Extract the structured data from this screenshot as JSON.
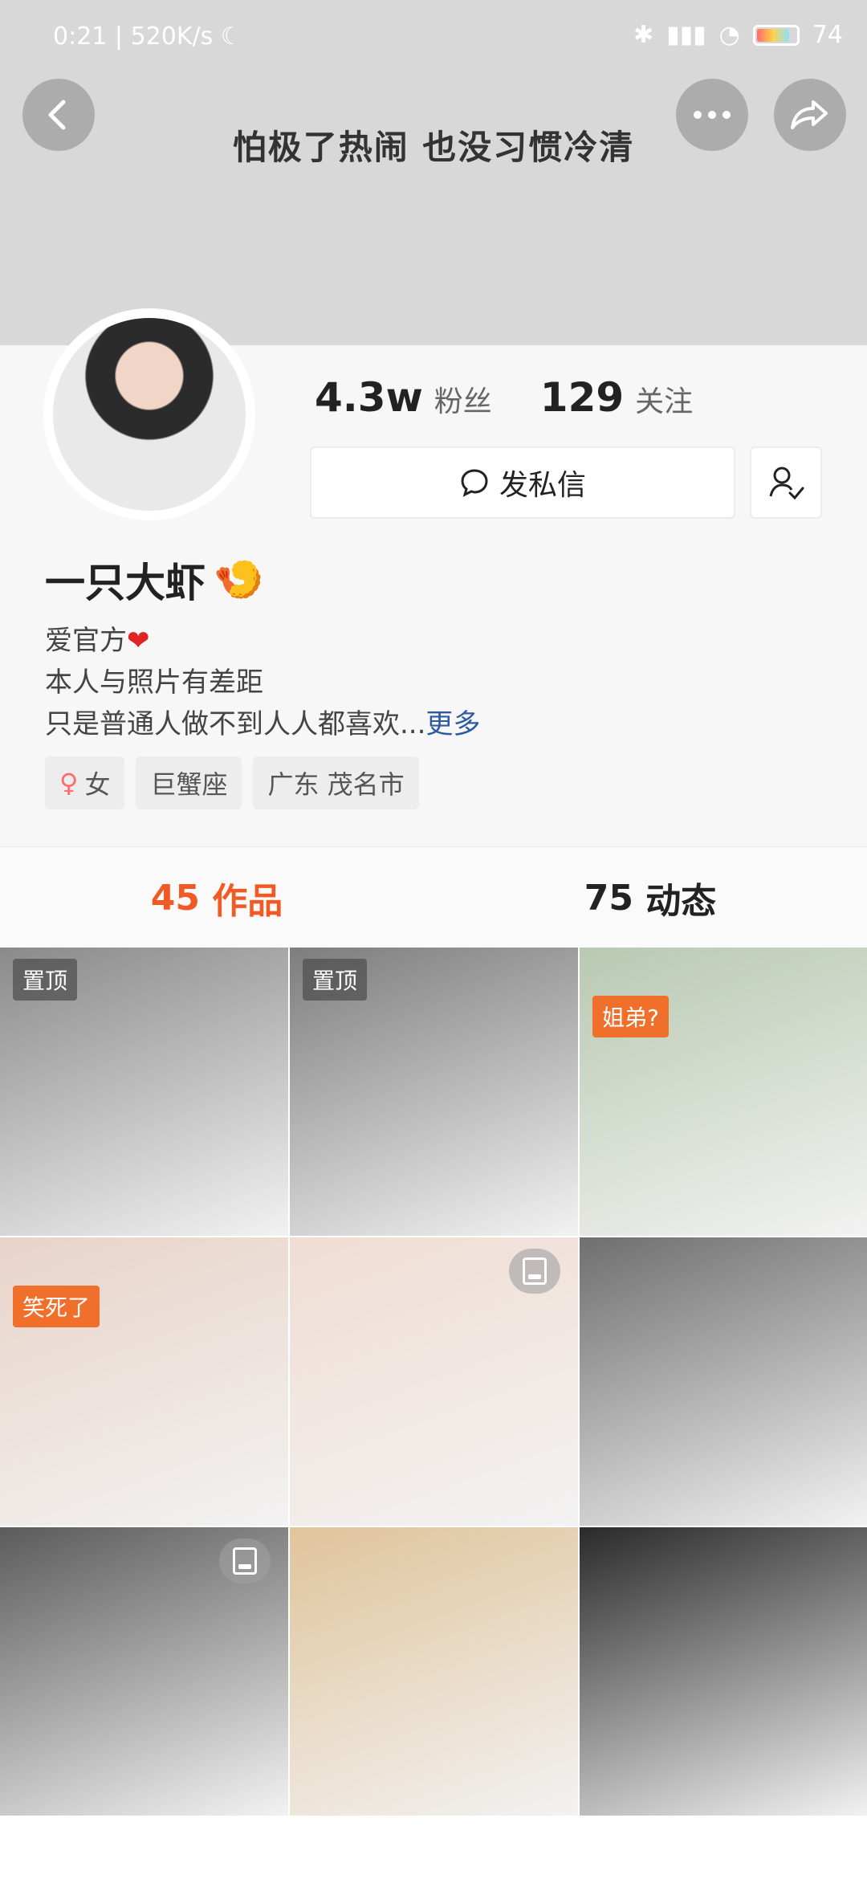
{
  "status_bar": {
    "time": "0:21",
    "speed": "520K/s",
    "battery": "74"
  },
  "header": {
    "signature": "怕极了热闹 也没习惯冷清"
  },
  "profile": {
    "followers_count": "4.3w",
    "followers_label": "粉丝",
    "following_count": "129",
    "following_label": "关注",
    "message_button": "发私信",
    "nickname": "一只大虾",
    "bio_lines": [
      "爱官方",
      "本人与照片有差距",
      "只是普通人做不到人人都喜欢..."
    ],
    "bio_more": "更多",
    "tags": [
      "女",
      "巨蟹座",
      "广东 茂名市"
    ]
  },
  "tabs": [
    {
      "count": "45",
      "label": "作品"
    },
    {
      "count": "75",
      "label": "动态"
    }
  ],
  "grid": [
    {
      "badge": "置顶",
      "color": "#8a8a8a"
    },
    {
      "badge": "置顶",
      "color": "#7d7d7d"
    },
    {
      "badge": "姐弟?",
      "color": "#b9c9b1"
    },
    {
      "badge": "笑死了",
      "color": "#e8d3c8"
    },
    {
      "photo": true,
      "color": "#f0ddd3"
    },
    {
      "color": "#6f6f6f"
    },
    {
      "photo": true,
      "color": "#5b5b5b"
    },
    {
      "color": "#e0c49b"
    },
    {
      "color": "#2a2a2a"
    }
  ],
  "accent_color": "#f15a24"
}
